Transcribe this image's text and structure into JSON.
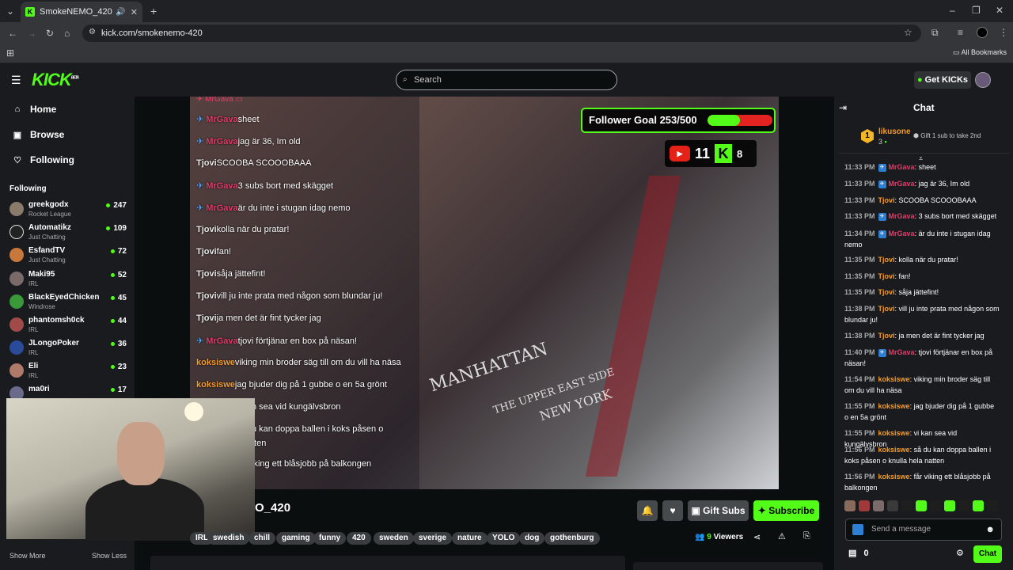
{
  "browser": {
    "tab_title": "SmokeNEMO_420 Stream",
    "url": "kick.com/smokenemo-420",
    "all_bookmarks": "All Bookmarks"
  },
  "header": {
    "logo": "KICK",
    "logo_beta": "BETA",
    "search_placeholder": "Search",
    "get_kicks": "Get KICKs"
  },
  "sidebar": {
    "nav": [
      "Home",
      "Browse",
      "Following"
    ],
    "following_heading": "Following",
    "following": [
      {
        "name": "greekgodx",
        "category": "Rocket League",
        "viewers": "247"
      },
      {
        "name": "Automatikz",
        "category": "Just Chatting",
        "viewers": "109"
      },
      {
        "name": "EsfandTV",
        "category": "Just Chatting",
        "viewers": "72"
      },
      {
        "name": "Maki95",
        "category": "IRL",
        "viewers": "52"
      },
      {
        "name": "BlackEyedChicken",
        "category": "Windrose",
        "viewers": "45"
      },
      {
        "name": "phantomsh0ck",
        "category": "IRL",
        "viewers": "44"
      },
      {
        "name": "JLongoPoker",
        "category": "IRL",
        "viewers": "36"
      },
      {
        "name": "Eli",
        "category": "IRL",
        "viewers": "23"
      },
      {
        "name": "ma0ri",
        "category": "",
        "viewers": "17"
      }
    ],
    "show_more": "Show More",
    "show_less": "Show Less"
  },
  "video": {
    "follower_goal": "Follower Goal 253/500",
    "goal_progress": 0.506,
    "youtube_count": "11",
    "kick_count": "8",
    "overlay_chat": [
      {
        "user": "MrGava",
        "text": "sheet",
        "color": "#e23b6a"
      },
      {
        "user": "MrGava",
        "text": "jag är 36, Im old",
        "color": "#e23b6a"
      },
      {
        "user": "Tjovi",
        "text": "SCOOBA SCOOOBAAA",
        "color": "#e9e9e9"
      },
      {
        "user": "MrGava",
        "text": "3 subs bort med skägget",
        "color": "#e23b6a"
      },
      {
        "user": "MrGava",
        "text": "är du inte i stugan idag nemo",
        "color": "#e23b6a"
      },
      {
        "user": "Tjovi",
        "text": "kolla när du pratar!",
        "color": "#e9e9e9"
      },
      {
        "user": "Tjovi",
        "text": "fan!",
        "color": "#e9e9e9"
      },
      {
        "user": "Tjovi",
        "text": "såja jättefint!",
        "color": "#e9e9e9"
      },
      {
        "user": "Tjovi",
        "text": "vill ju inte prata med någon som blundar ju!",
        "color": "#e9e9e9"
      },
      {
        "user": "Tjovi",
        "text": "ja men det är fint tycker jag",
        "color": "#e9e9e9"
      },
      {
        "user": "MrGava",
        "text": "tjovi förtjänar en box på näsan!",
        "color": "#e23b6a"
      },
      {
        "user": "koksiswe",
        "text": "viking min broder säg till om du vill ha näsa",
        "color": "#f59b2b"
      },
      {
        "user": "koksiswe",
        "text": "jag bjuder dig på 1 gubbe o en 5a grönt",
        "color": "#f59b2b"
      },
      {
        "user": "",
        "text": "n sea vid kungälvsbron",
        "color": "#e9e9e9"
      },
      {
        "user": "",
        "text": "u kan doppa ballen i koks påsen o",
        "color": "#e9e9e9"
      },
      {
        "user": "",
        "text": "tten",
        "color": "#e9e9e9"
      },
      {
        "user": "",
        "text": "iking ett blåsjobb på balkongen",
        "color": "#e9e9e9"
      }
    ],
    "shirt_text_1": "MANHATTAN",
    "shirt_text_2": "THE UPPER EAST SIDE",
    "shirt_text_3": "NEW YORK"
  },
  "stream": {
    "title_fragment": "O_420",
    "gift_subs": "Gift Subs",
    "subscribe": "Subscribe",
    "viewers_count": "9",
    "viewers_label": "Viewers",
    "tags": [
      "IRL",
      "swedish",
      "chill",
      "gaming",
      "funny",
      "420",
      "sweden",
      "sverige",
      "nature",
      "YOLO",
      "dog",
      "gothenburg"
    ]
  },
  "chat": {
    "title": "Chat",
    "pinned_rank": "1",
    "pinned_user": "likusone",
    "pinned_count": "3",
    "pinned_note": "Gift 1 sub to take 2nd",
    "messages": [
      {
        "time": "11:33 PM",
        "user": "MrGava",
        "text": ": sheet",
        "color": "#e23b6a",
        "badge": true
      },
      {
        "time": "11:33 PM",
        "user": "MrGava",
        "text": ": jag är 36, Im old",
        "color": "#e23b6a",
        "badge": true
      },
      {
        "time": "11:33 PM",
        "user": "Tjovi",
        "text": ": SCOOBA SCOOOBAAA",
        "color": "#f59b2b",
        "badge": false
      },
      {
        "time": "11:33 PM",
        "user": "MrGava",
        "text": ": 3 subs bort med skägget",
        "color": "#e23b6a",
        "badge": true
      },
      {
        "time": "11:34 PM",
        "user": "MrGava",
        "text": ": är du inte i stugan idag nemo",
        "color": "#e23b6a",
        "badge": true
      },
      {
        "time": "11:35 PM",
        "user": "Tjovi",
        "text": ": kolla när du pratar!",
        "color": "#f59b2b",
        "badge": false
      },
      {
        "time": "11:35 PM",
        "user": "Tjovi",
        "text": ": fan!",
        "color": "#f59b2b",
        "badge": false
      },
      {
        "time": "11:35 PM",
        "user": "Tjovi",
        "text": ": såja jättefint!",
        "color": "#f59b2b",
        "badge": false
      },
      {
        "time": "11:38 PM",
        "user": "Tjovi",
        "text": ": vill ju inte prata med någon som blundar ju!",
        "color": "#f59b2b",
        "badge": false
      },
      {
        "time": "11:38 PM",
        "user": "Tjovi",
        "text": ": ja men det är fint tycker jag",
        "color": "#f59b2b",
        "badge": false
      },
      {
        "time": "11:40 PM",
        "user": "MrGava",
        "text": ": tjovi förtjänar en box på näsan!",
        "color": "#e23b6a",
        "badge": true
      },
      {
        "time": "11:54 PM",
        "user": "koksiswe",
        "text": ": viking min broder säg till om du vill ha näsa",
        "color": "#f59b2b",
        "badge": false
      },
      {
        "time": "11:55 PM",
        "user": "koksiswe",
        "text": ": jag bjuder dig på 1 gubbe o en 5a grönt",
        "color": "#f59b2b",
        "badge": false
      },
      {
        "time": "11:55 PM",
        "user": "koksiswe",
        "text": ": vi kan sea vid kungälvsbron",
        "color": "#f59b2b",
        "badge": false
      },
      {
        "time": "11:56 PM",
        "user": "koksiswe",
        "text": ": så du kan doppa ballen i koks påsen o knulla hela natten",
        "color": "#f59b2b",
        "badge": false
      },
      {
        "time": "11:56 PM",
        "user": "koksiswe",
        "text": ": får viking ett blåsjobb på balkongen",
        "color": "#f59b2b",
        "badge": false
      }
    ],
    "send_placeholder": "Send a message",
    "kicks_balance": "0",
    "chat_button": "Chat"
  },
  "colors": {
    "accent": "#53fc18",
    "bg": "#0b0e0f",
    "panel": "#191b1f"
  }
}
